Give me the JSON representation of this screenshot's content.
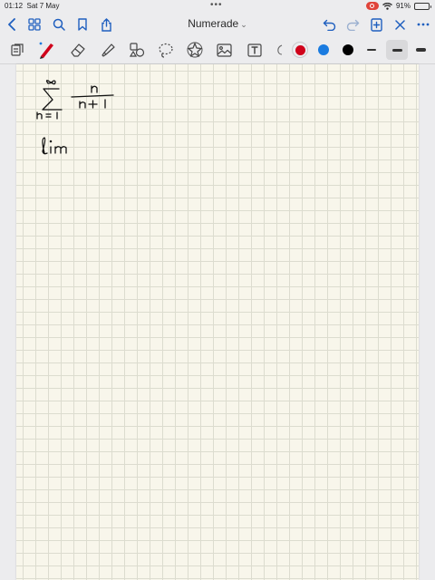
{
  "status": {
    "time": "01:12",
    "date": "Sat 7 May",
    "battery": "91%",
    "battery_level": 0.91,
    "dots": "•••"
  },
  "nav": {
    "title": "Numerade",
    "title_chevron": "⌄",
    "icons": [
      "back-icon",
      "grid-icon",
      "search-icon",
      "bookmark-icon",
      "share-icon",
      "undo-icon",
      "redo-icon",
      "add-page-icon",
      "close-icon"
    ]
  },
  "toolbar": {
    "tools": [
      "document-icon",
      "pen-icon",
      "eraser-icon",
      "highlighter-icon",
      "shapes-icon",
      "lasso-icon",
      "sticker-icon",
      "image-icon",
      "text-icon",
      "link-icon"
    ],
    "colors": [
      "#d0021b",
      "#1a7be0",
      "#000000"
    ],
    "selected_color": "#d0021b",
    "thicknesses": [
      "thin",
      "medium",
      "thick"
    ],
    "selected_thickness": "medium"
  }
}
